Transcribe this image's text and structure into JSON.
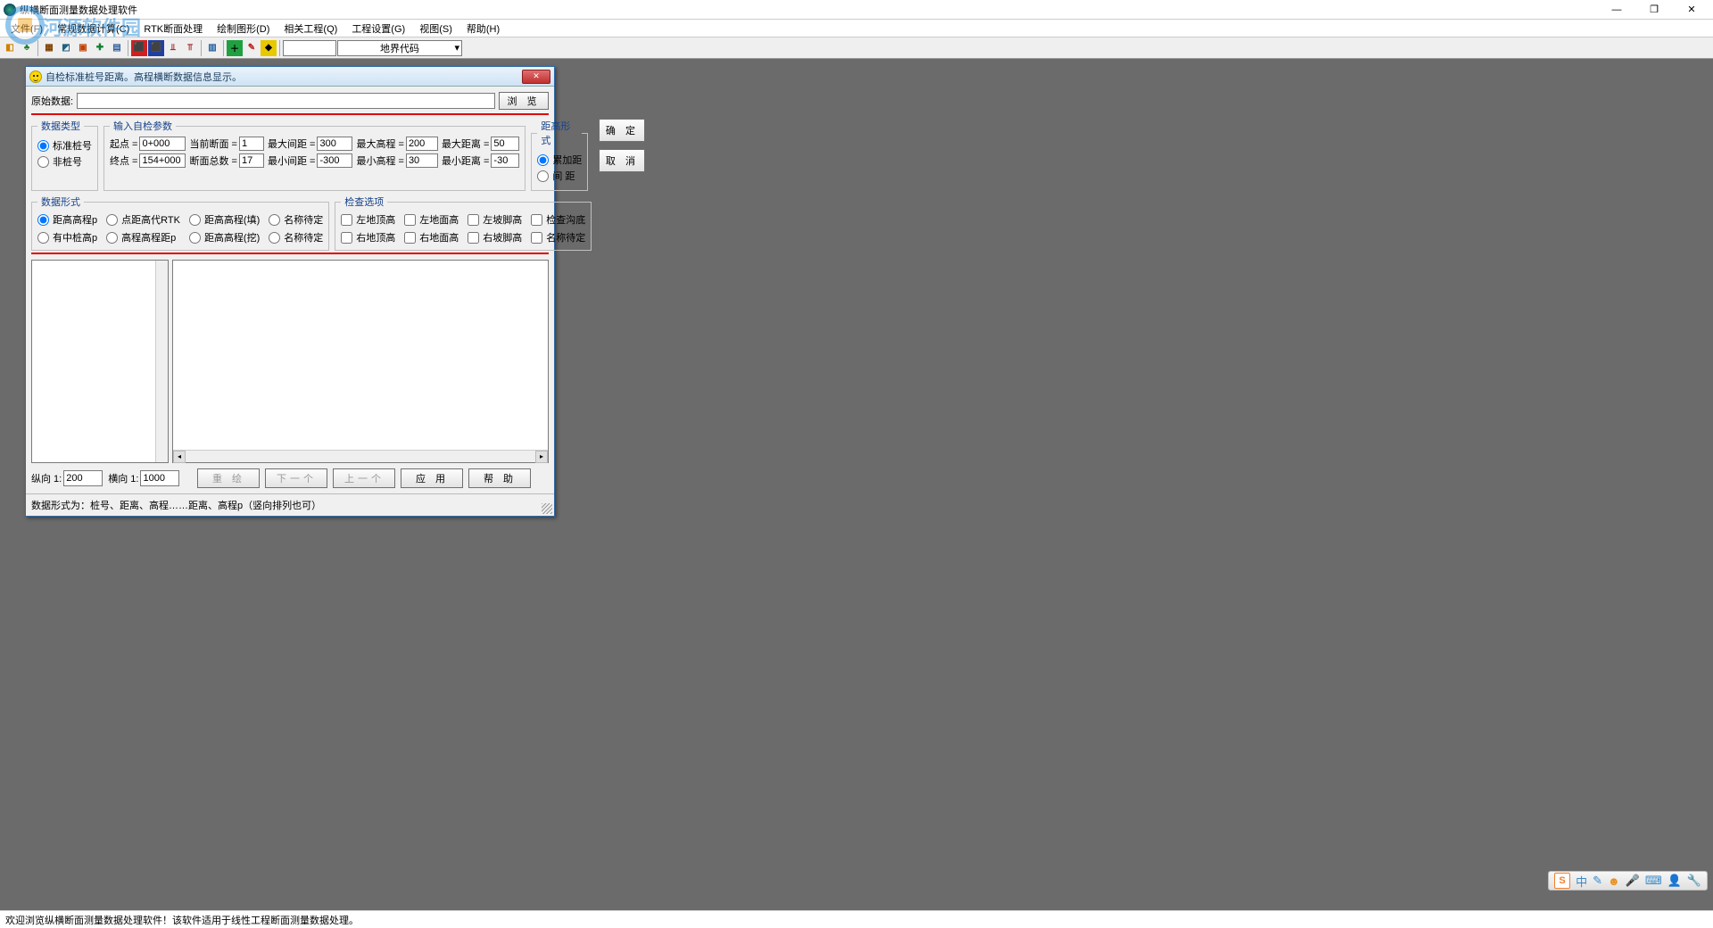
{
  "app": {
    "title": "纵横断面测量数据处理软件",
    "menus": [
      "文件(F)",
      "常规数据计算(C)",
      "RTK断面处理",
      "绘制图形(D)",
      "相关工程(Q)",
      "工程设置(G)",
      "视图(S)",
      "帮助(H)"
    ],
    "combo": "地界代码",
    "status": "欢迎浏览纵横断面测量数据处理软件！该软件适用于线性工程断面测量数据处理。"
  },
  "watermark": "河源软件园",
  "winctl": {
    "min": "—",
    "max": "❐",
    "close": "✕"
  },
  "dialog": {
    "title": "自检标准桩号距离。高程横断数据信息显示。",
    "src_label": "原始数据:",
    "browse": "浏 览",
    "fs1": {
      "legend": "数据类型",
      "r1": "标准桩号",
      "r2": "非桩号"
    },
    "fs2": {
      "legend": "输入自检参数",
      "items": {
        "start_l": "起点 =",
        "start_v": "0+000",
        "end_l": "终点 =",
        "end_v": "154+000",
        "cur_l": "当前断面 =",
        "cur_v": "1",
        "tot_l": "断面总数 =",
        "tot_v": "17",
        "maxd_l": "最大间距 =",
        "maxd_v": "300",
        "mind_l": "最小间距 =",
        "mind_v": "-300",
        "maxh_l": "最大高程 =",
        "maxh_v": "200",
        "minh_l": "最小高程 =",
        "minh_v": "30",
        "maxr_l": "最大距离 =",
        "maxr_v": "50",
        "minr_l": "最小距离 =",
        "minr_v": "-30"
      }
    },
    "fs3": {
      "legend": "距高形式",
      "r1": "累加距",
      "r2": "间 距"
    },
    "ok": "确 定",
    "cancel": "取 消",
    "fs4": {
      "legend": "数据形式",
      "opts": [
        "距高高程p",
        "点距高代RTK",
        "距高高程(填)",
        "名称待定",
        "有中桩高p",
        "高程高程距p",
        "距高高程(挖)",
        "名称待定"
      ]
    },
    "fs5": {
      "legend": "检查选项",
      "opts": [
        "左地顶高",
        "左地面高",
        "左坡脚高",
        "检查沟底",
        "右地顶高",
        "右地面高",
        "右坡脚高",
        "名称待定"
      ]
    },
    "nav": {
      "vs_l": "纵向 1:",
      "vs_v": "200",
      "hs_l": "横向 1:",
      "hs_v": "1000",
      "redraw": "重 绘",
      "next": "下一个",
      "prev": "上一个",
      "apply": "应 用",
      "help": "帮 助"
    },
    "dlg_status": "数据形式为：桩号、距离、高程……距离、高程p（竖向排列也可）"
  },
  "ime": {
    "s": "S",
    "zhong": "中",
    "icons": [
      "✎",
      "☻",
      "🎤",
      "⌨",
      "👤",
      "🔧"
    ]
  }
}
